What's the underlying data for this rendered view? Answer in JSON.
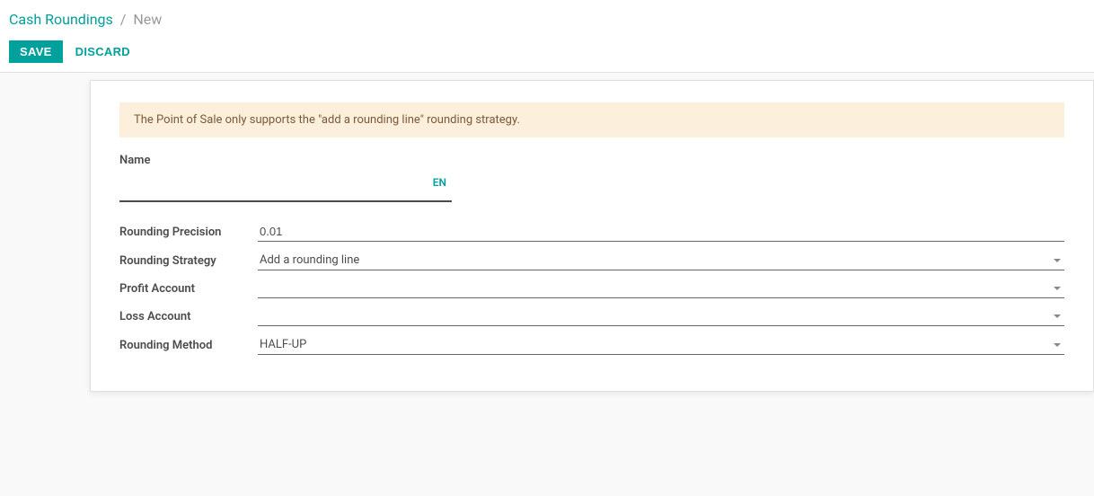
{
  "breadcrumb": {
    "root": "Cash Roundings",
    "current": "New"
  },
  "actions": {
    "save": "SAVE",
    "discard": "DISCARD"
  },
  "alert": "The Point of Sale only supports the \"add a rounding line\" rounding strategy.",
  "fields": {
    "name_label": "Name",
    "name_value": "",
    "lang_badge": "EN",
    "rounding_precision_label": "Rounding Precision",
    "rounding_precision_value": "0.01",
    "rounding_strategy_label": "Rounding Strategy",
    "rounding_strategy_value": "Add a rounding line",
    "profit_account_label": "Profit Account",
    "profit_account_value": "",
    "loss_account_label": "Loss Account",
    "loss_account_value": "",
    "rounding_method_label": "Rounding Method",
    "rounding_method_value": "HALF-UP"
  }
}
